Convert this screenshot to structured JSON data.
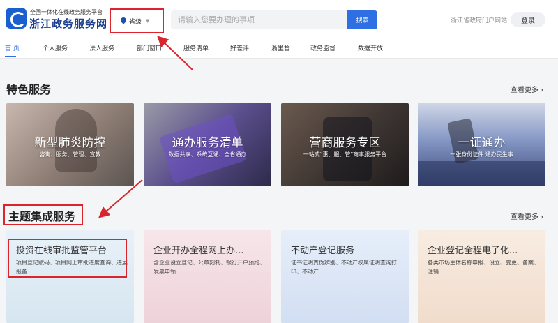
{
  "header": {
    "logo_subtitle": "全国一体化在线政务服务平台",
    "logo_title": "浙江政务服务网",
    "region": "省级",
    "search_placeholder": "请输入您要办理的事项",
    "search_button": "搜索",
    "portal_link": "浙江省政府门户网站",
    "login_button": "登录"
  },
  "nav": {
    "items": [
      "首 页",
      "个人服务",
      "法人服务",
      "部门窗口",
      "服务清单",
      "好差评",
      "浙里督",
      "政务监督",
      "数据开放"
    ]
  },
  "featured": {
    "title": "特色服务",
    "more": "查看更多",
    "cards": [
      {
        "title": "新型肺炎防控",
        "subtitle": "咨询、服务、管理、宣教"
      },
      {
        "title": "通办服务清单",
        "subtitle": "数据共享、系统互通、全省通办"
      },
      {
        "title": "营商服务专区",
        "subtitle": "一站式\"惠、服、管\"商事服务平台"
      },
      {
        "title": "一证通办",
        "subtitle": "一张身份证件 通办民生事"
      }
    ]
  },
  "themes": {
    "title": "主题集成服务",
    "more": "查看更多",
    "cards": [
      {
        "title": "投资在线审批监管平台",
        "desc": "项目登记赋码、项目网上审批进度查询、进展报备"
      },
      {
        "title": "企业开办全程网上办...",
        "desc": "含企业设立登记、公章刻制、银行开户预约、发票申领..."
      },
      {
        "title": "不动产登记服务",
        "desc": "证书证明真伪辨别、不动产权属证明查询打印、不动产..."
      },
      {
        "title": "企业登记全程电子化...",
        "desc": "各类市场主体名称申报、设立、变更、备案、注销"
      }
    ]
  },
  "colors": {
    "brand": "#1a5fd0",
    "accent": "#2f6fe4",
    "annotation": "#d9252b"
  }
}
